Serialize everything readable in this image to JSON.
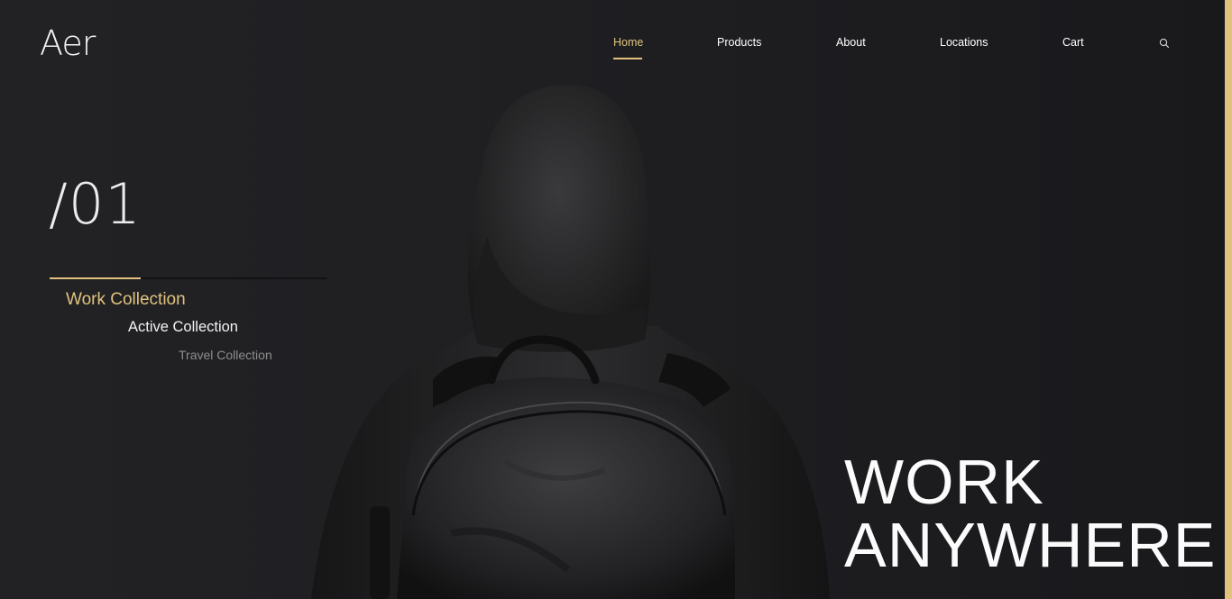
{
  "brand": {
    "logo": "Aer"
  },
  "nav": {
    "items": [
      {
        "label": "Home",
        "active": true
      },
      {
        "label": "Products",
        "active": false
      },
      {
        "label": "About",
        "active": false
      },
      {
        "label": "Locations",
        "active": false
      },
      {
        "label": "Cart",
        "active": false
      }
    ],
    "search_icon": "search-icon"
  },
  "hero": {
    "slide_number": "/01",
    "slide_progress": 0.33,
    "collections": [
      {
        "label": "Work Collection",
        "active": true
      },
      {
        "label": "Active Collection",
        "active": false
      },
      {
        "label": "Travel Collection",
        "active": false
      }
    ],
    "headline_line1": "WORK",
    "headline_line2": "ANYWHERE"
  },
  "colors": {
    "accent": "#e0c27e",
    "background": "#1f1f22",
    "text": "#ffffff"
  }
}
